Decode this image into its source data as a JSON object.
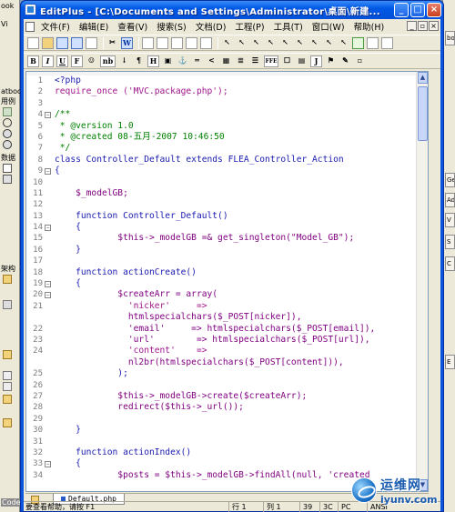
{
  "window": {
    "title": "EditPlus - [C:\\Documents and Settings\\Administrator\\桌面\\新建..."
  },
  "menu": {
    "items": [
      "文件(F)",
      "编辑(E)",
      "查看(V)",
      "搜索(S)",
      "文档(D)",
      "工程(P)",
      "工具(T)",
      "窗口(W)",
      "帮助(H)"
    ]
  },
  "background_left": {
    "labels": [
      "ook",
      "Vi",
      "atboo",
      "用例",
      "数据",
      "架构",
      "Code"
    ]
  },
  "background_right": {
    "buttons": [
      "boo",
      "Ge",
      "Adv",
      "V",
      "S",
      "C",
      "E"
    ]
  },
  "toolbar2_labels": [
    "B",
    "I",
    "U",
    "F",
    "nb",
    "H",
    "FFE",
    "J"
  ],
  "editor": {
    "lines": [
      {
        "n": "1",
        "fold": "",
        "text": "<?php"
      },
      {
        "n": "2",
        "fold": "",
        "text": "require_once ('MVC.package.php');"
      },
      {
        "n": "3",
        "fold": "",
        "text": ""
      },
      {
        "n": "4",
        "fold": "⊟",
        "text": "/**"
      },
      {
        "n": "5",
        "fold": "",
        "text": " * @version 1.0"
      },
      {
        "n": "6",
        "fold": "",
        "text": " * @created 08-五月-2007 10:46:50"
      },
      {
        "n": "7",
        "fold": "",
        "text": " */"
      },
      {
        "n": "8",
        "fold": "",
        "text": "class Controller_Default extends FLEA_Controller_Action"
      },
      {
        "n": "9",
        "fold": "⊟",
        "text": "{"
      },
      {
        "n": "10",
        "fold": "",
        "text": ""
      },
      {
        "n": "11",
        "fold": "",
        "text": "    $_modelGB;"
      },
      {
        "n": "12",
        "fold": "",
        "text": ""
      },
      {
        "n": "13",
        "fold": "",
        "text": "    function Controller_Default()"
      },
      {
        "n": "14",
        "fold": "⊟",
        "text": "    {"
      },
      {
        "n": "15",
        "fold": "",
        "text": "            $this->_modelGB =& get_singleton(\"Model_GB\");"
      },
      {
        "n": "16",
        "fold": "",
        "text": "    }"
      },
      {
        "n": "17",
        "fold": "",
        "text": ""
      },
      {
        "n": "18",
        "fold": "",
        "text": "    function actionCreate()"
      },
      {
        "n": "19",
        "fold": "⊟",
        "text": "    {"
      },
      {
        "n": "20",
        "fold": "⊟",
        "text": "            $createArr = array("
      },
      {
        "n": "21",
        "fold": "",
        "text": "              'nicker'     =>"
      },
      {
        "n": "",
        "fold": "",
        "text": "              htmlspecialchars($_POST[nicker]),"
      },
      {
        "n": "22",
        "fold": "",
        "text": "              'email'     => htmlspecialchars($_POST[email]),"
      },
      {
        "n": "23",
        "fold": "",
        "text": "              'url'        => htmlspecialchars($_POST[url]),"
      },
      {
        "n": "24",
        "fold": "",
        "text": "              'content'    =>"
      },
      {
        "n": "",
        "fold": "",
        "text": "              nl2br(htmlspecialchars($_POST[content])),"
      },
      {
        "n": "25",
        "fold": "",
        "text": "            );"
      },
      {
        "n": "26",
        "fold": "",
        "text": ""
      },
      {
        "n": "27",
        "fold": "",
        "text": "            $this->_modelGB->create($createArr);"
      },
      {
        "n": "28",
        "fold": "",
        "text": "            redirect($this->_url());"
      },
      {
        "n": "29",
        "fold": "",
        "text": ""
      },
      {
        "n": "30",
        "fold": "",
        "text": "    }"
      },
      {
        "n": "31",
        "fold": "",
        "text": ""
      },
      {
        "n": "32",
        "fold": "",
        "text": "    function actionIndex()"
      },
      {
        "n": "33",
        "fold": "⊟",
        "text": "    {"
      },
      {
        "n": "34",
        "fold": "",
        "text": "            $posts = $this->_modelGB->findAll(null, 'created"
      }
    ]
  },
  "tabs": [
    {
      "label": "Default.php"
    }
  ],
  "status": {
    "help": "要查看帮助，请按 F1",
    "line": "行 1",
    "col": "列 1",
    "code1": "39",
    "code2": "3C",
    "mode": "PC",
    "encoding": "ANSI"
  },
  "watermark": {
    "name": "运维网",
    "url": "iyunv.com"
  }
}
